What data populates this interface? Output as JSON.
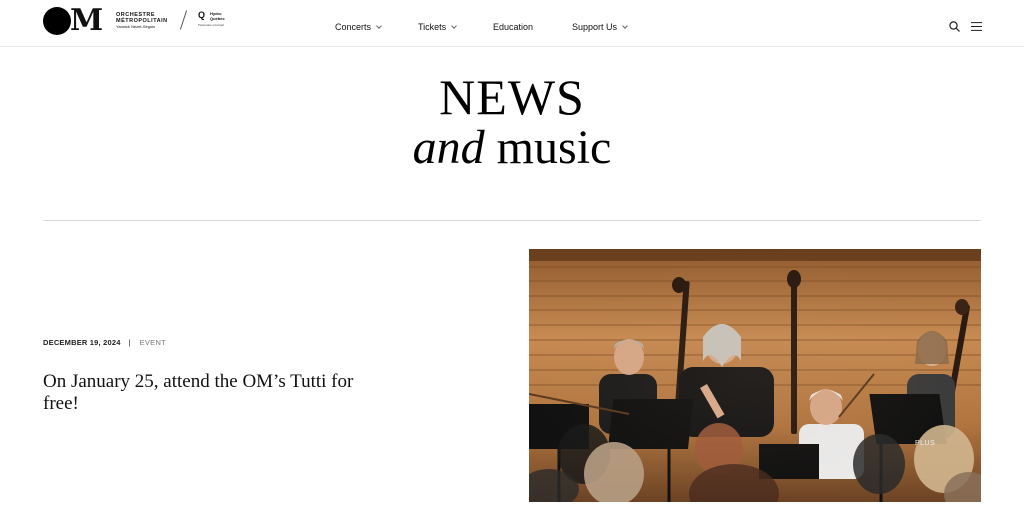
{
  "header": {
    "logo_mark": "M",
    "logo_name_line1": "ORCHESTRE",
    "logo_name_line2": "MÉTROPOLITAIN",
    "logo_subtitle": "Yannick Nézet-Séguin",
    "partner_mark": "Q",
    "partner_line1": "Hydro",
    "partner_line2": "Québec",
    "partner_subtitle": "Partenaire principal"
  },
  "nav": {
    "items": [
      {
        "label": "Concerts",
        "has_dropdown": true
      },
      {
        "label": "Tickets",
        "has_dropdown": true
      },
      {
        "label": "Education",
        "has_dropdown": false
      },
      {
        "label": "Support Us",
        "has_dropdown": true
      }
    ]
  },
  "icons": {
    "search": "search-icon",
    "menu": "hamburger-menu-icon"
  },
  "page": {
    "title_line1": "NEWS",
    "title_line2_italic": "and",
    "title_line2_rest": " music"
  },
  "article": {
    "date": "DECEMBER 19, 2024",
    "separator": "|",
    "category": "EVENT",
    "headline": "On January 25, attend the OM’s Tutti for free!",
    "image_overlay_label": "PLUS"
  }
}
